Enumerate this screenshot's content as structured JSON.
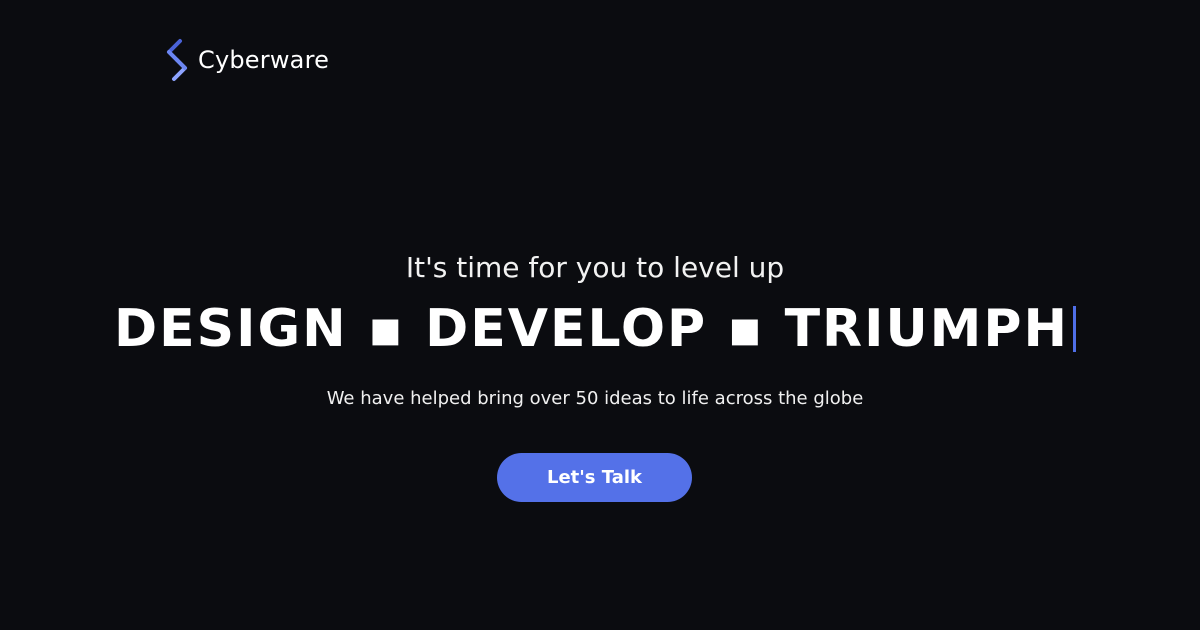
{
  "brand": {
    "name": "Cyberware",
    "logo_icon": "cyberware-s-logo-icon",
    "logo_color": "#5f7ef0"
  },
  "hero": {
    "tagline": "It's time for you to level up",
    "headline": "DESIGN ▪ DEVELOP ▪ TRIUMPH",
    "subtext": "We have helped bring over 50 ideas to life across the globe",
    "cta_label": "Let's Talk"
  },
  "colors": {
    "background": "#0b0c10",
    "accent": "#5471e8",
    "text": "#ffffff"
  }
}
